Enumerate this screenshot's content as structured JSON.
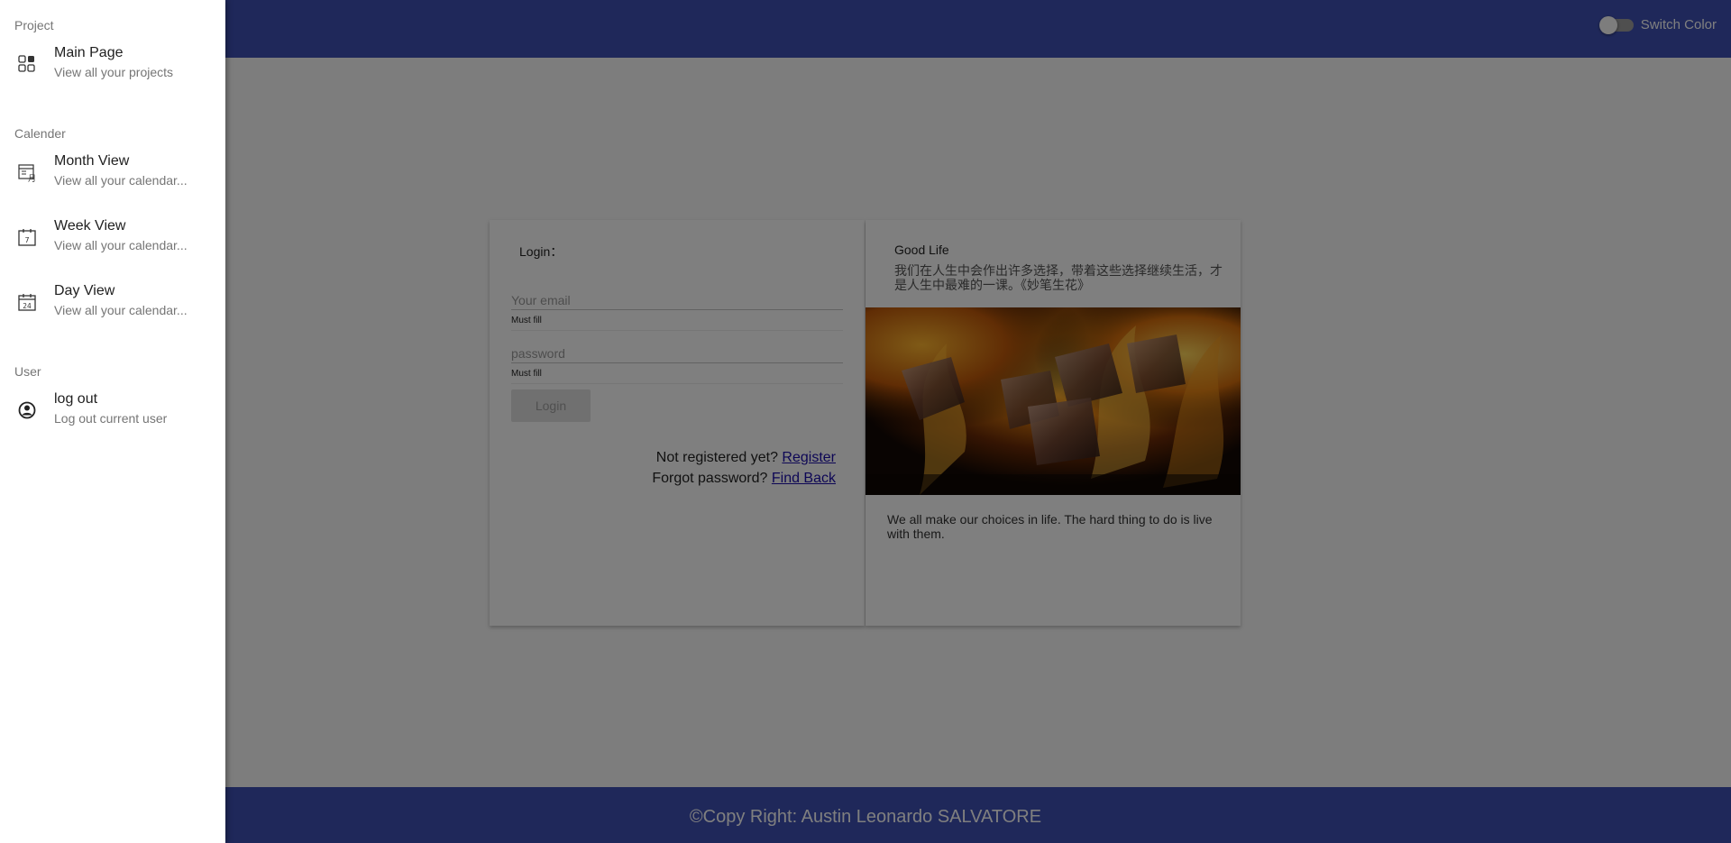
{
  "header": {
    "switch_label": "Switch Color",
    "switch_on": false,
    "bar_color": "#3f51b5"
  },
  "login": {
    "title": "Login：",
    "email_placeholder": "Your email",
    "email_value": "",
    "email_hint": "Must fill",
    "password_placeholder": "password",
    "password_value": "",
    "password_hint": "Must fill",
    "login_button": "Login",
    "not_registered_text": "Not registered yet?",
    "register_link": "Register",
    "forgot_text": "Forgot password?",
    "find_back_link": "Find Back"
  },
  "quote": {
    "title": "Good Life",
    "chinese_text": "我们在人生中会作出许多选择，带着这些选择继续生活，才是人生中最难的一课。《妙笔生花》",
    "image_icon": "fire-and-ice-photo",
    "english_text": "We all make our choices in life. The hard thing to do is live with them."
  },
  "footer": {
    "copyright": "©Copy Right: Austin Leonardo SALVATORE"
  },
  "drawer": {
    "sections": [
      {
        "subheader": "Project",
        "items": [
          {
            "icon": "dashboard-icon",
            "primary": "Main Page",
            "secondary": "View all your projects"
          }
        ]
      },
      {
        "subheader": "Calender",
        "items": [
          {
            "icon": "month-calendar-icon",
            "primary": "Month View",
            "secondary": "View all your calendar..."
          },
          {
            "icon": "week-calendar-icon",
            "primary": "Week View",
            "secondary": "View all your calendar..."
          },
          {
            "icon": "day-calendar-icon",
            "primary": "Day View",
            "secondary": "View all your calendar..."
          }
        ]
      },
      {
        "subheader": "User",
        "items": [
          {
            "icon": "account-circle-icon",
            "primary": "log out",
            "secondary": "Log out current user"
          }
        ]
      }
    ],
    "week_icon_number": "7",
    "day_icon_number": "24",
    "month_icon_char": "月"
  },
  "overlay": {
    "backdrop_color": "rgba(0,0,0,0.5)"
  }
}
